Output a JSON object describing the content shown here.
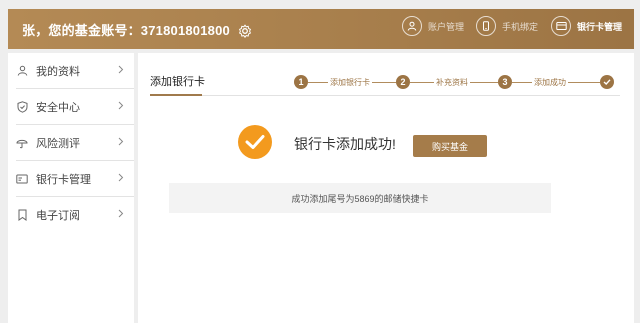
{
  "header": {
    "account_text": "张，您的基金账号：371801801800",
    "nav": [
      {
        "label": "账户管理",
        "icon": "user-icon"
      },
      {
        "label": "手机绑定",
        "icon": "phone-icon"
      },
      {
        "label": "银行卡管理",
        "icon": "card-icon"
      }
    ]
  },
  "sidebar": {
    "items": [
      {
        "label": "我的资料",
        "icon": "user-icon"
      },
      {
        "label": "安全中心",
        "icon": "shield-icon"
      },
      {
        "label": "风险测评",
        "icon": "umbrella-icon"
      },
      {
        "label": "银行卡管理",
        "icon": "card-icon"
      },
      {
        "label": "电子订阅",
        "icon": "bookmark-icon"
      }
    ]
  },
  "main": {
    "tab_title": "添加银行卡",
    "steps": [
      {
        "num": "1",
        "label": "添加银行卡"
      },
      {
        "num": "2",
        "label": "补充资料"
      },
      {
        "num": "3",
        "label": "添加成功"
      }
    ],
    "success_message": "银行卡添加成功!",
    "buy_button": "购买基金",
    "notice": "成功添加尾号为5869的邮储快捷卡"
  },
  "colors": {
    "brand": "#a57c4a",
    "success": "#f39a1e"
  }
}
